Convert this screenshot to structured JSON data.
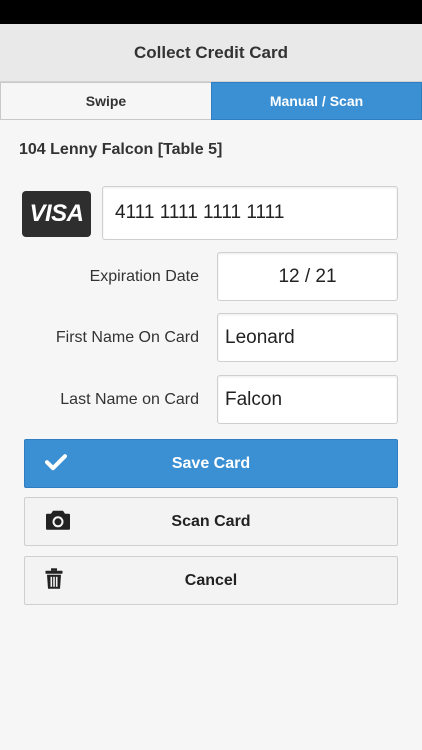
{
  "header": {
    "title": "Collect Credit Card"
  },
  "tabs": [
    {
      "label": "Swipe",
      "active": false
    },
    {
      "label": "Manual / Scan",
      "active": true
    }
  ],
  "customer": {
    "label": "104 Lenny Falcon [Table 5]"
  },
  "card": {
    "brand": "VISA",
    "number": "4111 1111 1111 1111",
    "expiration_label": "Expiration Date",
    "expiration_value": "12 / 21",
    "first_name_label": "First Name On Card",
    "first_name_value": "Leonard",
    "last_name_label": "Last Name on Card",
    "last_name_value": "Falcon"
  },
  "buttons": {
    "save": {
      "label": "Save Card",
      "icon": "check-icon"
    },
    "scan": {
      "label": "Scan Card",
      "icon": "camera-icon"
    },
    "cancel": {
      "label": "Cancel",
      "icon": "trash-icon"
    }
  },
  "colors": {
    "accent": "#3b8fd3",
    "background": "#f6f6f6",
    "header": "#e9e9e9"
  }
}
